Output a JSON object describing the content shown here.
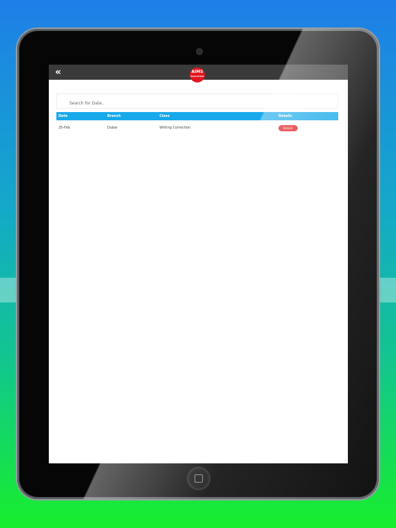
{
  "app": {
    "logo_text": "AIMS",
    "logo_subtext": "EDUCATION"
  },
  "search": {
    "placeholder": "Search for Date.."
  },
  "table": {
    "headers": [
      "Date",
      "Branch",
      "Class",
      "Details"
    ],
    "rows": [
      {
        "date": "25-Feb",
        "branch": "Dubai",
        "class": "Writing Correction",
        "details_label": "Details"
      }
    ]
  },
  "colors": {
    "header_bar": "#3a3a3a",
    "table_header": "#17a9ea",
    "details_button": "#e01a1a",
    "logo": "#e0161f"
  },
  "icons": {
    "back": "double-chevron-left-icon",
    "home": "home-button-icon"
  }
}
